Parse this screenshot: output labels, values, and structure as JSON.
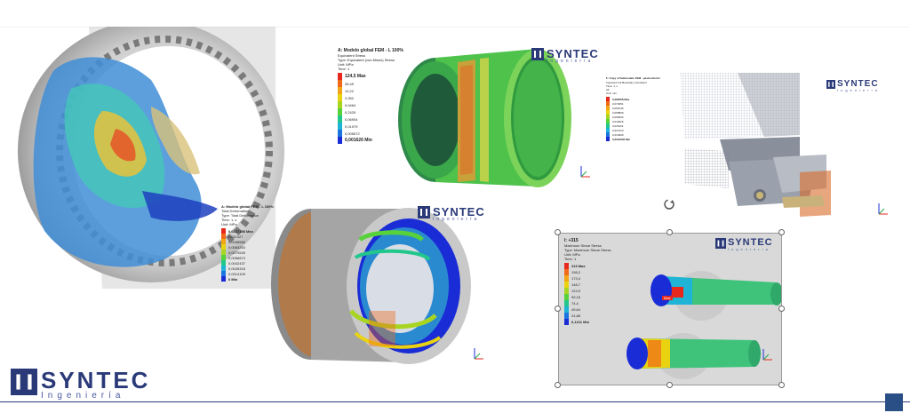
{
  "brand": {
    "name": "SYNTEC",
    "sub": "Ingeniería",
    "color": "#2a3a78"
  },
  "panel_top_center": {
    "title": "A: Modelo global FEM - L 100%",
    "lines": [
      "Equivalent Stress",
      "Type: Equivalent (von-Mises) Stress",
      "Unit: MPa",
      "Time: 1"
    ],
    "max_label": "124,5 Max",
    "values": [
      "35,49",
      "10,22",
      "2,952",
      "0,9464",
      "0,2429",
      "0,06904",
      "0,01979",
      "0,005672"
    ],
    "min_label": "0,001626 Min"
  },
  "panel_top_right": {
    "title": "F: Copy of Submodelo FEM - pasta inferior",
    "lines": [
      "Imported Cut Boundary Constraint",
      "Time: 1, s",
      "All",
      "Unit: mm"
    ],
    "max_label": "0,082558 Max",
    "values": [
      "0,074651",
      "0,066745",
      "0,058839",
      "0,050932",
      "0,043026",
      "0,035119",
      "0,027213",
      "0,019306"
    ],
    "min_label": "0,0034002 Min"
  },
  "panel_mid_left": {
    "title": "A: Modelo global FEM - L 100%",
    "lines": [
      "Total Deformation",
      "Type: Total Deformation",
      "Time: 1, s",
      "Unit: MPa"
    ],
    "max_label": "0,0127138 Max",
    "values": [
      "0,011027",
      "0,0098560",
      "0,0084254",
      "0,0070545",
      "0,0056874",
      "0,0042437",
      "0,0028318",
      "0,0014109"
    ],
    "min_label": "0 Min"
  },
  "panel_bottom_right": {
    "title": "I: +315",
    "lines": [
      "Maximum Shear Stress",
      "Type: Maximum Shear Stress",
      "Unit: MPa",
      "Time: 1"
    ],
    "max_label": "223 Max",
    "values": [
      "198,2",
      "173,4",
      "148,7",
      "123,9",
      "99,16",
      "74,4",
      "49,64",
      "24,88"
    ],
    "min_label": "0,1211 Min",
    "probe_label": "Max"
  },
  "colors": {
    "scale": [
      "#e8281c",
      "#f06a19",
      "#f2a615",
      "#e9d310",
      "#a8d522",
      "#58d23a",
      "#22c78b",
      "#1fb4d6",
      "#1b73e0",
      "#1a2cd6"
    ]
  }
}
